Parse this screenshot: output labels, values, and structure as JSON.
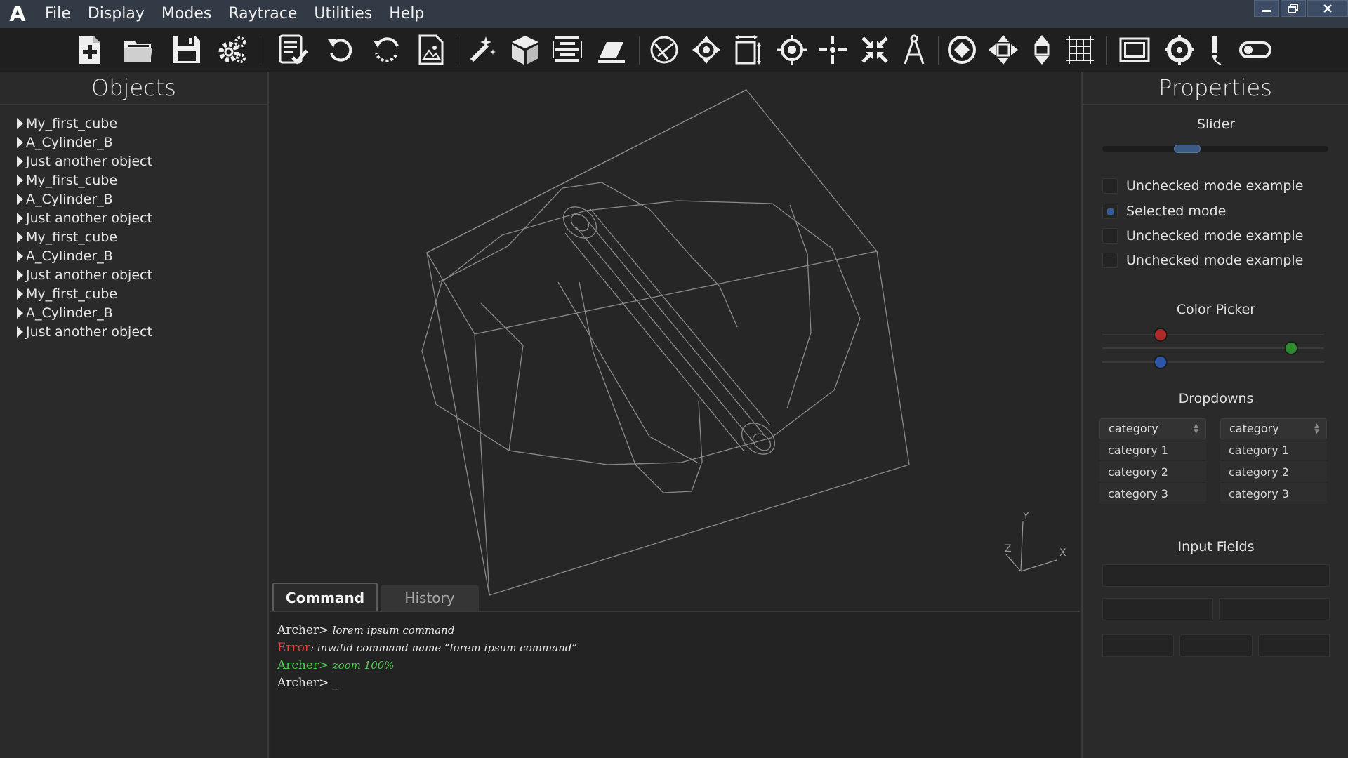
{
  "app": {
    "logo_letter": "A"
  },
  "menu": [
    "File",
    "Display",
    "Modes",
    "Raytrace",
    "Utilities",
    "Help"
  ],
  "toolbar": {
    "groups": [
      [
        "new-file-icon",
        "open-folder-icon",
        "save-icon",
        "settings-gears-icon"
      ],
      [
        "checklist-icon",
        "undo-icon",
        "reload-icon",
        "image-file-icon"
      ],
      [
        "magic-wand-icon",
        "cube-icon",
        "align-icon",
        "eraser-icon"
      ],
      [
        "rotate-object-icon",
        "pan-icon",
        "scale-icon",
        "target-icon",
        "center-icon",
        "collapse-icon",
        "compass-icon"
      ],
      [
        "rotate-view-icon",
        "move-view-icon",
        "vertical-move-icon",
        "grid-icon"
      ],
      [
        "screen-icon",
        "crosshair-icon",
        "pen-icon",
        "toggle-icon"
      ]
    ]
  },
  "objects_panel": {
    "title": "Objects",
    "items": [
      "My_first_cube",
      "A_Cylinder_B",
      "Just another object",
      "My_first_cube",
      "A_Cylinder_B",
      "Just another object",
      "My_first_cube",
      "A_Cylinder_B",
      "Just another object",
      "My_first_cube",
      "A_Cylinder_B",
      "Just another object"
    ]
  },
  "viewport": {
    "axis_labels": {
      "x": "X",
      "y": "Y",
      "z": "Z"
    }
  },
  "command": {
    "tabs": [
      {
        "label": "Command",
        "active": true
      },
      {
        "label": "History",
        "active": false
      }
    ],
    "lines": [
      {
        "type": "normal",
        "prefix": "Archer>",
        "text": "lorem ipsum command"
      },
      {
        "type": "error",
        "prefix": "Error",
        "text": ": invalid command name “lorem ipsum command”"
      },
      {
        "type": "ok",
        "prefix": "Archer>",
        "text": "zoom 100%"
      },
      {
        "type": "normal",
        "prefix": "Archer>",
        "text": "_"
      }
    ]
  },
  "properties_panel": {
    "title": "Properties",
    "slider": {
      "label": "Slider",
      "value": 0.36
    },
    "modes": [
      {
        "label": "Unchecked mode example",
        "checked": false
      },
      {
        "label": "Selected mode",
        "checked": true
      },
      {
        "label": "Unchecked mode example",
        "checked": false
      },
      {
        "label": "Unchecked mode example",
        "checked": false
      }
    ],
    "color_picker": {
      "label": "Color Picker",
      "channels": [
        {
          "name": "red",
          "value": 0.25,
          "color": "#b02a2a"
        },
        {
          "name": "green",
          "value": 0.87,
          "color": "#2f8a2f"
        },
        {
          "name": "blue",
          "value": 0.25,
          "color": "#2c55a8"
        }
      ]
    },
    "dropdowns": {
      "label": "Dropdowns",
      "lists": [
        {
          "selected": "category",
          "options": [
            "category 1",
            "category 2",
            "category 3"
          ]
        },
        {
          "selected": "category",
          "options": [
            "category 1",
            "category 2",
            "category 3"
          ]
        }
      ]
    },
    "input_fields": {
      "label": "Input Fields"
    }
  },
  "colors": {
    "accent": "#3b5b82",
    "error": "#e0403a",
    "success": "#4fd04f",
    "menubar": "#323a45"
  }
}
